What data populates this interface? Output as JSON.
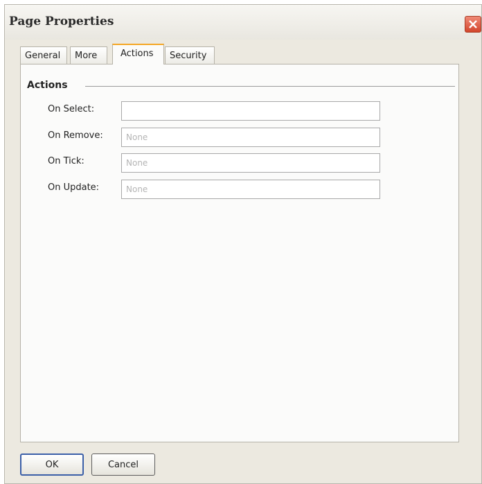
{
  "window": {
    "title": "Page Properties",
    "close_icon": "close-icon"
  },
  "tabs": [
    {
      "label": "General",
      "active": false
    },
    {
      "label": "More",
      "active": false
    },
    {
      "label": "Actions",
      "active": true
    },
    {
      "label": "Security",
      "active": false
    }
  ],
  "section": {
    "title": "Actions"
  },
  "fields": [
    {
      "label": "On Select:",
      "value": "",
      "placeholder": ""
    },
    {
      "label": "On Remove:",
      "value": "",
      "placeholder": "None"
    },
    {
      "label": "On Tick:",
      "value": "",
      "placeholder": "None"
    },
    {
      "label": "On Update:",
      "value": "",
      "placeholder": "None"
    }
  ],
  "buttons": {
    "ok_label": "OK",
    "cancel_label": "Cancel"
  },
  "colors": {
    "active_tab_accent": "#f5a623",
    "close_button": "#d2452c",
    "default_button_border": "#3b5fa8"
  }
}
